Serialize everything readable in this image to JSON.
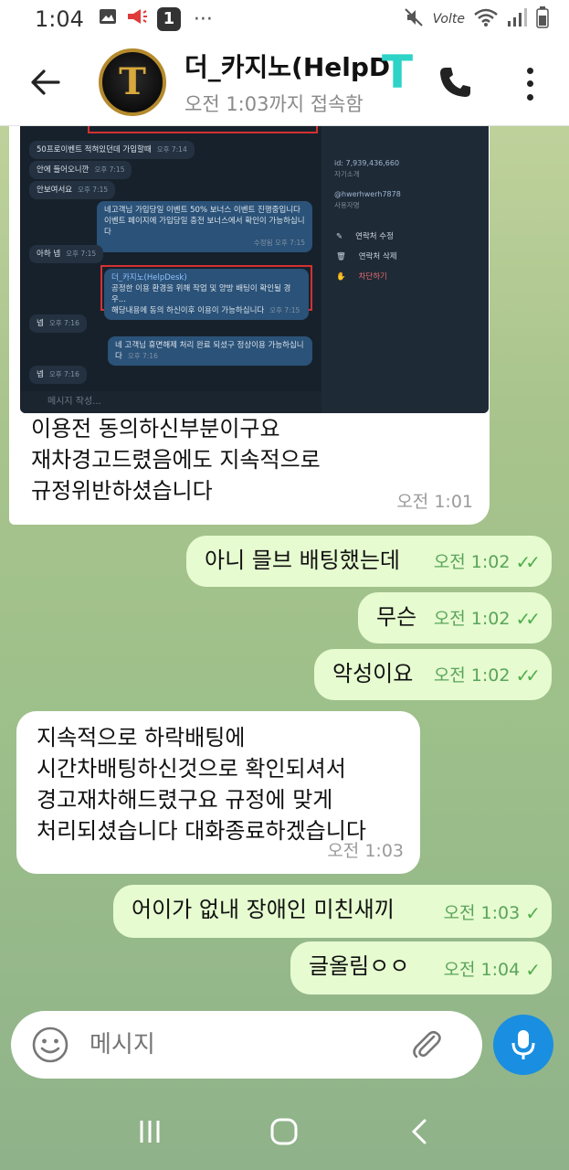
{
  "status_bar": {
    "time": "1:04",
    "notification_count": "1",
    "dots": "···",
    "network": "Volte"
  },
  "header": {
    "title": "더_카지노(HelpD",
    "subtitle": "오전 1:03까지 접속함",
    "avatar_letter": "T",
    "overlay_mark": "T"
  },
  "embedded_screenshot": {
    "messages": [
      {
        "text": "50프로이벤트 적혀있던데 가입할때",
        "time": "오후 7:14",
        "dir": "in"
      },
      {
        "text": "안에 들어오니깐",
        "time": "오후 7:15",
        "dir": "in"
      },
      {
        "text": "안보여서요",
        "time": "오후 7:15",
        "dir": "in"
      },
      {
        "text": "네고객님 가입당일 이벤트 50% 보너스 이벤트 진행중입니다",
        "text2": "이벤트 페이지에 가입당일 충전 보너스에서 확인이 가능하십니다",
        "time": "수정됨 오후 7:15",
        "dir": "out"
      },
      {
        "text": "아하 넵",
        "time": "오후 7:15",
        "dir": "in"
      },
      {
        "text": "더_카지노(HelpDesk)",
        "text2": "공정한 이용 환경을 위해 작업 및 양방 배팅이 확인될 경우...",
        "text3": "해당내용에 동의 하신이후 이용이 가능하십니다",
        "time": "오후 7:15",
        "dir": "out"
      },
      {
        "text": "넵",
        "time": "오후 7:16",
        "dir": "in"
      },
      {
        "text": "네 고객님 휴면해제 처리 완료 되셨구 정상이용 가능하십니다",
        "time": "오후 7:16",
        "dir": "out"
      },
      {
        "text": "넵",
        "time": "오후 7:16",
        "dir": "in"
      }
    ],
    "input_placeholder": "메시지 작성...",
    "profile": {
      "id": "id: 7,939,436,660",
      "id_label": "자기소개",
      "username": "@hwerhwerh7878",
      "username_label": "사용자명",
      "actions": [
        "연락처 수정",
        "연락처 삭제",
        "차단하기"
      ]
    }
  },
  "messages": [
    {
      "dir": "in",
      "lines": [
        "이용전 동의하신부분이구요",
        "재차경고드렸음에도 지속적으로",
        "규정위반하셨습니다"
      ],
      "time": "오전 1:01"
    },
    {
      "dir": "out",
      "lines": [
        "아니 믈브 배팅했는데"
      ],
      "time": "오전 1:02",
      "read": "✓✓"
    },
    {
      "dir": "out",
      "lines": [
        "무슨"
      ],
      "time": "오전 1:02",
      "read": "✓✓"
    },
    {
      "dir": "out",
      "lines": [
        "악성이요"
      ],
      "time": "오전 1:02",
      "read": "✓✓"
    },
    {
      "dir": "in",
      "lines": [
        "지속적으로 하락배팅에",
        "시간차배팅하신것으로 확인되셔서",
        "경고재차해드렸구요 규정에 맞게",
        "처리되셨습니다 대화종료하겠습니다"
      ],
      "time": "오전 1:03"
    },
    {
      "dir": "out",
      "lines": [
        "어이가 없내 장애인 미친새끼"
      ],
      "time": "오전 1:03",
      "read": "✓"
    },
    {
      "dir": "out",
      "lines": [
        "글올림ㅇㅇ"
      ],
      "time": "오전 1:04",
      "read": "✓"
    }
  ],
  "input": {
    "placeholder": "메시지"
  },
  "colors": {
    "outgoing_bubble": "#e6fbd0",
    "incoming_bubble": "#ffffff",
    "accent": "#1a8ee0",
    "check": "#4fae4e"
  }
}
